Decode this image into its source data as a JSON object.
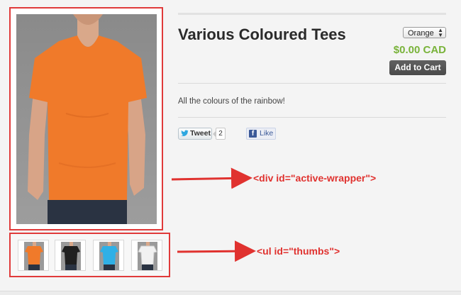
{
  "product": {
    "title": "Various Coloured Tees",
    "variant_selected": "Orange",
    "price": "$0.00 CAD",
    "add_to_cart_label": "Add to Cart",
    "description": "All the colours of the rainbow!"
  },
  "social": {
    "tweet_label": "Tweet",
    "tweet_count": "2",
    "like_label": "Like"
  },
  "gallery": {
    "active_color": "#f07a2a",
    "thumbs": [
      {
        "color": "#f07a2a"
      },
      {
        "color": "#1f1f1f"
      },
      {
        "color": "#2fb0e6"
      },
      {
        "color": "#f1f1f1"
      }
    ]
  },
  "annotations": {
    "active_wrapper": "<div id=\"active-wrapper\">",
    "thumbs": "<ul id=\"thumbs\">",
    "color": "#e0322f"
  }
}
